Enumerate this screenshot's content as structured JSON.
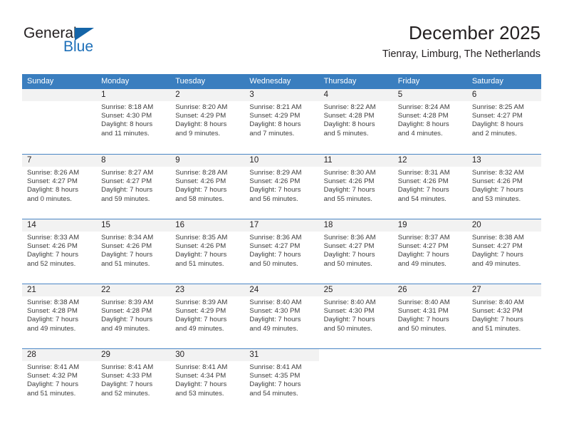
{
  "brand": {
    "name_line1": "General",
    "name_line2": "Blue",
    "color_dark": "#231f20",
    "color_blue": "#1d6fb8"
  },
  "header": {
    "title": "December 2025",
    "subtitle": "Tienray, Limburg, The Netherlands"
  },
  "theme": {
    "header_row_bg": "#3a7ebf",
    "daynum_band_bg": "#f2f2f2",
    "row_divider": "#4a86c5",
    "text": "#231f20"
  },
  "weekdays": [
    "Sunday",
    "Monday",
    "Tuesday",
    "Wednesday",
    "Thursday",
    "Friday",
    "Saturday"
  ],
  "weeks": [
    [
      {
        "day": "",
        "sunrise": "",
        "sunset": "",
        "daylight_line1": "",
        "daylight_line2": "",
        "empty": true
      },
      {
        "day": "1",
        "sunrise": "Sunrise: 8:18 AM",
        "sunset": "Sunset: 4:30 PM",
        "daylight_line1": "Daylight: 8 hours",
        "daylight_line2": "and 11 minutes."
      },
      {
        "day": "2",
        "sunrise": "Sunrise: 8:20 AM",
        "sunset": "Sunset: 4:29 PM",
        "daylight_line1": "Daylight: 8 hours",
        "daylight_line2": "and 9 minutes."
      },
      {
        "day": "3",
        "sunrise": "Sunrise: 8:21 AM",
        "sunset": "Sunset: 4:29 PM",
        "daylight_line1": "Daylight: 8 hours",
        "daylight_line2": "and 7 minutes."
      },
      {
        "day": "4",
        "sunrise": "Sunrise: 8:22 AM",
        "sunset": "Sunset: 4:28 PM",
        "daylight_line1": "Daylight: 8 hours",
        "daylight_line2": "and 5 minutes."
      },
      {
        "day": "5",
        "sunrise": "Sunrise: 8:24 AM",
        "sunset": "Sunset: 4:28 PM",
        "daylight_line1": "Daylight: 8 hours",
        "daylight_line2": "and 4 minutes."
      },
      {
        "day": "6",
        "sunrise": "Sunrise: 8:25 AM",
        "sunset": "Sunset: 4:27 PM",
        "daylight_line1": "Daylight: 8 hours",
        "daylight_line2": "and 2 minutes."
      }
    ],
    [
      {
        "day": "7",
        "sunrise": "Sunrise: 8:26 AM",
        "sunset": "Sunset: 4:27 PM",
        "daylight_line1": "Daylight: 8 hours",
        "daylight_line2": "and 0 minutes."
      },
      {
        "day": "8",
        "sunrise": "Sunrise: 8:27 AM",
        "sunset": "Sunset: 4:27 PM",
        "daylight_line1": "Daylight: 7 hours",
        "daylight_line2": "and 59 minutes."
      },
      {
        "day": "9",
        "sunrise": "Sunrise: 8:28 AM",
        "sunset": "Sunset: 4:26 PM",
        "daylight_line1": "Daylight: 7 hours",
        "daylight_line2": "and 58 minutes."
      },
      {
        "day": "10",
        "sunrise": "Sunrise: 8:29 AM",
        "sunset": "Sunset: 4:26 PM",
        "daylight_line1": "Daylight: 7 hours",
        "daylight_line2": "and 56 minutes."
      },
      {
        "day": "11",
        "sunrise": "Sunrise: 8:30 AM",
        "sunset": "Sunset: 4:26 PM",
        "daylight_line1": "Daylight: 7 hours",
        "daylight_line2": "and 55 minutes."
      },
      {
        "day": "12",
        "sunrise": "Sunrise: 8:31 AM",
        "sunset": "Sunset: 4:26 PM",
        "daylight_line1": "Daylight: 7 hours",
        "daylight_line2": "and 54 minutes."
      },
      {
        "day": "13",
        "sunrise": "Sunrise: 8:32 AM",
        "sunset": "Sunset: 4:26 PM",
        "daylight_line1": "Daylight: 7 hours",
        "daylight_line2": "and 53 minutes."
      }
    ],
    [
      {
        "day": "14",
        "sunrise": "Sunrise: 8:33 AM",
        "sunset": "Sunset: 4:26 PM",
        "daylight_line1": "Daylight: 7 hours",
        "daylight_line2": "and 52 minutes."
      },
      {
        "day": "15",
        "sunrise": "Sunrise: 8:34 AM",
        "sunset": "Sunset: 4:26 PM",
        "daylight_line1": "Daylight: 7 hours",
        "daylight_line2": "and 51 minutes."
      },
      {
        "day": "16",
        "sunrise": "Sunrise: 8:35 AM",
        "sunset": "Sunset: 4:26 PM",
        "daylight_line1": "Daylight: 7 hours",
        "daylight_line2": "and 51 minutes."
      },
      {
        "day": "17",
        "sunrise": "Sunrise: 8:36 AM",
        "sunset": "Sunset: 4:27 PM",
        "daylight_line1": "Daylight: 7 hours",
        "daylight_line2": "and 50 minutes."
      },
      {
        "day": "18",
        "sunrise": "Sunrise: 8:36 AM",
        "sunset": "Sunset: 4:27 PM",
        "daylight_line1": "Daylight: 7 hours",
        "daylight_line2": "and 50 minutes."
      },
      {
        "day": "19",
        "sunrise": "Sunrise: 8:37 AM",
        "sunset": "Sunset: 4:27 PM",
        "daylight_line1": "Daylight: 7 hours",
        "daylight_line2": "and 49 minutes."
      },
      {
        "day": "20",
        "sunrise": "Sunrise: 8:38 AM",
        "sunset": "Sunset: 4:27 PM",
        "daylight_line1": "Daylight: 7 hours",
        "daylight_line2": "and 49 minutes."
      }
    ],
    [
      {
        "day": "21",
        "sunrise": "Sunrise: 8:38 AM",
        "sunset": "Sunset: 4:28 PM",
        "daylight_line1": "Daylight: 7 hours",
        "daylight_line2": "and 49 minutes."
      },
      {
        "day": "22",
        "sunrise": "Sunrise: 8:39 AM",
        "sunset": "Sunset: 4:28 PM",
        "daylight_line1": "Daylight: 7 hours",
        "daylight_line2": "and 49 minutes."
      },
      {
        "day": "23",
        "sunrise": "Sunrise: 8:39 AM",
        "sunset": "Sunset: 4:29 PM",
        "daylight_line1": "Daylight: 7 hours",
        "daylight_line2": "and 49 minutes."
      },
      {
        "day": "24",
        "sunrise": "Sunrise: 8:40 AM",
        "sunset": "Sunset: 4:30 PM",
        "daylight_line1": "Daylight: 7 hours",
        "daylight_line2": "and 49 minutes."
      },
      {
        "day": "25",
        "sunrise": "Sunrise: 8:40 AM",
        "sunset": "Sunset: 4:30 PM",
        "daylight_line1": "Daylight: 7 hours",
        "daylight_line2": "and 50 minutes."
      },
      {
        "day": "26",
        "sunrise": "Sunrise: 8:40 AM",
        "sunset": "Sunset: 4:31 PM",
        "daylight_line1": "Daylight: 7 hours",
        "daylight_line2": "and 50 minutes."
      },
      {
        "day": "27",
        "sunrise": "Sunrise: 8:40 AM",
        "sunset": "Sunset: 4:32 PM",
        "daylight_line1": "Daylight: 7 hours",
        "daylight_line2": "and 51 minutes."
      }
    ],
    [
      {
        "day": "28",
        "sunrise": "Sunrise: 8:41 AM",
        "sunset": "Sunset: 4:32 PM",
        "daylight_line1": "Daylight: 7 hours",
        "daylight_line2": "and 51 minutes."
      },
      {
        "day": "29",
        "sunrise": "Sunrise: 8:41 AM",
        "sunset": "Sunset: 4:33 PM",
        "daylight_line1": "Daylight: 7 hours",
        "daylight_line2": "and 52 minutes."
      },
      {
        "day": "30",
        "sunrise": "Sunrise: 8:41 AM",
        "sunset": "Sunset: 4:34 PM",
        "daylight_line1": "Daylight: 7 hours",
        "daylight_line2": "and 53 minutes."
      },
      {
        "day": "31",
        "sunrise": "Sunrise: 8:41 AM",
        "sunset": "Sunset: 4:35 PM",
        "daylight_line1": "Daylight: 7 hours",
        "daylight_line2": "and 54 minutes."
      },
      {
        "day": "",
        "sunrise": "",
        "sunset": "",
        "daylight_line1": "",
        "daylight_line2": "",
        "empty": true,
        "blank": true
      },
      {
        "day": "",
        "sunrise": "",
        "sunset": "",
        "daylight_line1": "",
        "daylight_line2": "",
        "empty": true,
        "blank": true
      },
      {
        "day": "",
        "sunrise": "",
        "sunset": "",
        "daylight_line1": "",
        "daylight_line2": "",
        "empty": true,
        "blank": true
      }
    ]
  ]
}
